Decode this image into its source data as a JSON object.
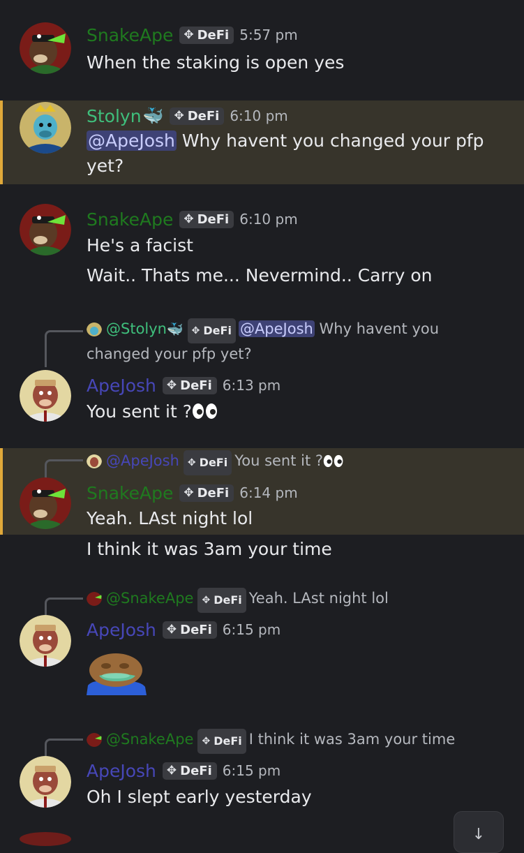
{
  "colors": {
    "background": "#1d1e22",
    "highlight_background": "#37342b",
    "highlight_bar": "#e0a93a",
    "snakeape_name": "#1f7a1f",
    "stolyn_name": "#3fbf7c",
    "apejosh_name": "#4747b8",
    "mention_background": "#3e4275"
  },
  "tag_icon": "diamond-arrows-icon",
  "messages": [
    {
      "author": "SnakeApe",
      "tag": "DeFi",
      "time": "5:57 pm",
      "lines": [
        "When the staking is open yes"
      ]
    },
    {
      "author": "Stolyn",
      "author_icon": "whale-icon",
      "tag": "DeFi",
      "time": "6:10 pm",
      "mention": "@ApeJosh",
      "line1_rest": " Why havent you changed your pfp",
      "line2": "yet?"
    },
    {
      "author": "SnakeApe",
      "tag": "DeFi",
      "time": "6:10 pm",
      "lines": [
        "He's a facist",
        "Wait.. Thats me... Nevermind.. Carry on"
      ]
    },
    {
      "reply_to": {
        "name": "@Stolyn",
        "name_icon": "whale-icon",
        "tag": "DeFi",
        "mention": "@ApeJosh",
        "text": " Why havent you",
        "text2": "changed your pfp yet?"
      },
      "author": "ApeJosh",
      "tag": "DeFi",
      "time": "6:13 pm",
      "lines": [
        "You sent it ?"
      ],
      "emoji": "eyes-icon"
    },
    {
      "reply_to": {
        "name": "@ApeJosh",
        "tag": "DeFi",
        "text": "You sent it ?",
        "emoji": "eyes-icon"
      },
      "author": "SnakeApe",
      "tag": "DeFi",
      "time": "6:14 pm",
      "lines": [
        "Yeah. LAst night lol",
        "I think it was 3am your time"
      ]
    },
    {
      "reply_to": {
        "name": "@SnakeApe",
        "tag": "DeFi",
        "text": "Yeah. LAst night lol"
      },
      "author": "ApeJosh",
      "tag": "DeFi",
      "time": "6:15 pm",
      "sticker": "pepe-face-sticker"
    },
    {
      "reply_to": {
        "name": "@SnakeApe",
        "tag": "DeFi",
        "text": "I think it was 3am your time"
      },
      "author": "ApeJosh",
      "tag": "DeFi",
      "time": "6:15 pm",
      "lines": [
        "Oh I slept early yesterday"
      ]
    }
  ],
  "scroll_button_icon": "arrow-down-icon"
}
